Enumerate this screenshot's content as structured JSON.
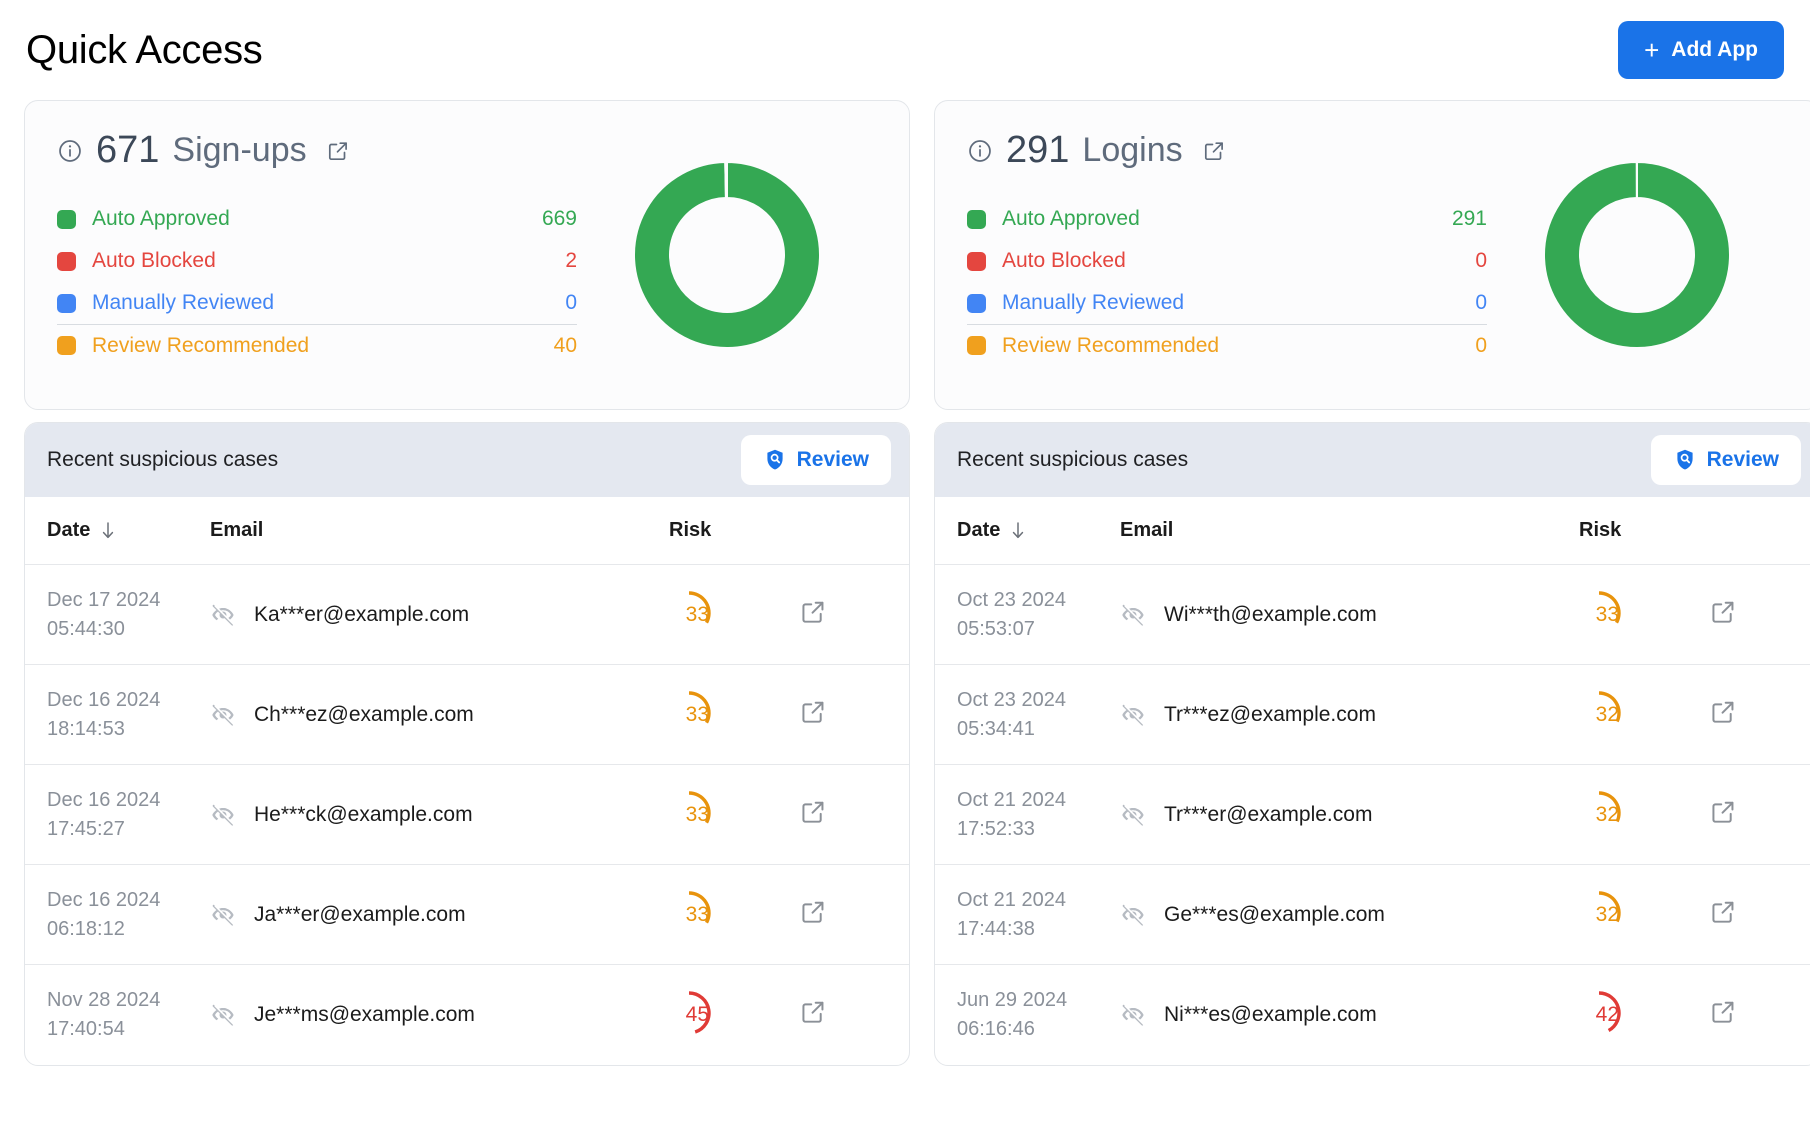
{
  "header": {
    "title": "Quick Access",
    "add_app_label": "Add App",
    "add_app_plus": "+"
  },
  "colors": {
    "accent": "#1a73e8",
    "green": "#34a853",
    "red": "#e4463f",
    "blue": "#4285f4",
    "orange": "#f0a01e",
    "risk_orange": "#e8930c",
    "risk_red": "#e03b36",
    "header_bar": "#e4e8f0"
  },
  "panels": [
    {
      "summary": {
        "info_icon": "info-icon",
        "count": "671",
        "label": "Sign-ups",
        "external_icon": "open-in-new-icon",
        "legend": [
          {
            "label": "Auto Approved",
            "value": "669",
            "color": "#34a853",
            "divider": false
          },
          {
            "label": "Auto Blocked",
            "value": "2",
            "color": "#e4463f",
            "divider": false
          },
          {
            "label": "Manually Reviewed",
            "value": "0",
            "color": "#4285f4",
            "divider": false
          },
          {
            "label": "Review Recommended",
            "value": "40",
            "color": "#f0a01e",
            "divider": true
          }
        ],
        "donut": {
          "type": "pie",
          "title": "671 Sign-ups",
          "categories": [
            "Auto Approved",
            "Auto Blocked",
            "Manually Reviewed",
            "Review Recommended"
          ],
          "values": [
            669,
            2,
            0,
            0
          ],
          "colors": [
            "#34a853",
            "#e4463f",
            "#4285f4",
            "#f0a01e"
          ],
          "total": 671
        }
      },
      "cases": {
        "title": "Recent suspicious cases",
        "review_label": "Review",
        "review_icon": "shield-search-icon",
        "columns": [
          "Date",
          "Email",
          "Risk",
          ""
        ],
        "sort_column": "Date",
        "sort_direction": "desc",
        "rows": [
          {
            "date": "Dec 17 2024",
            "time": "05:44:30",
            "email": "Ka***er@example.com",
            "risk": "33",
            "risk_color": "#e8930c",
            "visibility_icon": "eye-off-icon",
            "open_icon": "open-in-new-icon"
          },
          {
            "date": "Dec 16 2024",
            "time": "18:14:53",
            "email": "Ch***ez@example.com",
            "risk": "33",
            "risk_color": "#e8930c",
            "visibility_icon": "eye-off-icon",
            "open_icon": "open-in-new-icon"
          },
          {
            "date": "Dec 16 2024",
            "time": "17:45:27",
            "email": "He***ck@example.com",
            "risk": "33",
            "risk_color": "#e8930c",
            "visibility_icon": "eye-off-icon",
            "open_icon": "open-in-new-icon"
          },
          {
            "date": "Dec 16 2024",
            "time": "06:18:12",
            "email": "Ja***er@example.com",
            "risk": "33",
            "risk_color": "#e8930c",
            "visibility_icon": "eye-off-icon",
            "open_icon": "open-in-new-icon"
          },
          {
            "date": "Nov 28 2024",
            "time": "17:40:54",
            "email": "Je***ms@example.com",
            "risk": "45",
            "risk_color": "#e03b36",
            "visibility_icon": "eye-off-icon",
            "open_icon": "open-in-new-icon"
          }
        ]
      }
    },
    {
      "summary": {
        "info_icon": "info-icon",
        "count": "291",
        "label": "Logins",
        "external_icon": "open-in-new-icon",
        "legend": [
          {
            "label": "Auto Approved",
            "value": "291",
            "color": "#34a853",
            "divider": false
          },
          {
            "label": "Auto Blocked",
            "value": "0",
            "color": "#e4463f",
            "divider": false
          },
          {
            "label": "Manually Reviewed",
            "value": "0",
            "color": "#4285f4",
            "divider": false
          },
          {
            "label": "Review Recommended",
            "value": "0",
            "color": "#f0a01e",
            "divider": true
          }
        ],
        "donut": {
          "type": "pie",
          "title": "291 Logins",
          "categories": [
            "Auto Approved",
            "Auto Blocked",
            "Manually Reviewed",
            "Review Recommended"
          ],
          "values": [
            291,
            0,
            0,
            0
          ],
          "colors": [
            "#34a853",
            "#e4463f",
            "#4285f4",
            "#f0a01e"
          ],
          "total": 291
        }
      },
      "cases": {
        "title": "Recent suspicious cases",
        "review_label": "Review",
        "review_icon": "shield-search-icon",
        "columns": [
          "Date",
          "Email",
          "Risk",
          ""
        ],
        "sort_column": "Date",
        "sort_direction": "desc",
        "rows": [
          {
            "date": "Oct 23 2024",
            "time": "05:53:07",
            "email": "Wi***th@example.com",
            "risk": "33",
            "risk_color": "#e8930c",
            "visibility_icon": "eye-off-icon",
            "open_icon": "open-in-new-icon"
          },
          {
            "date": "Oct 23 2024",
            "time": "05:34:41",
            "email": "Tr***ez@example.com",
            "risk": "32",
            "risk_color": "#e8930c",
            "visibility_icon": "eye-off-icon",
            "open_icon": "open-in-new-icon"
          },
          {
            "date": "Oct 21 2024",
            "time": "17:52:33",
            "email": "Tr***er@example.com",
            "risk": "32",
            "risk_color": "#e8930c",
            "visibility_icon": "eye-off-icon",
            "open_icon": "open-in-new-icon"
          },
          {
            "date": "Oct 21 2024",
            "time": "17:44:38",
            "email": "Ge***es@example.com",
            "risk": "32",
            "risk_color": "#e8930c",
            "visibility_icon": "eye-off-icon",
            "open_icon": "open-in-new-icon"
          },
          {
            "date": "Jun 29 2024",
            "time": "06:16:46",
            "email": "Ni***es@example.com",
            "risk": "42",
            "risk_color": "#e03b36",
            "visibility_icon": "eye-off-icon",
            "open_icon": "open-in-new-icon"
          }
        ]
      }
    }
  ]
}
